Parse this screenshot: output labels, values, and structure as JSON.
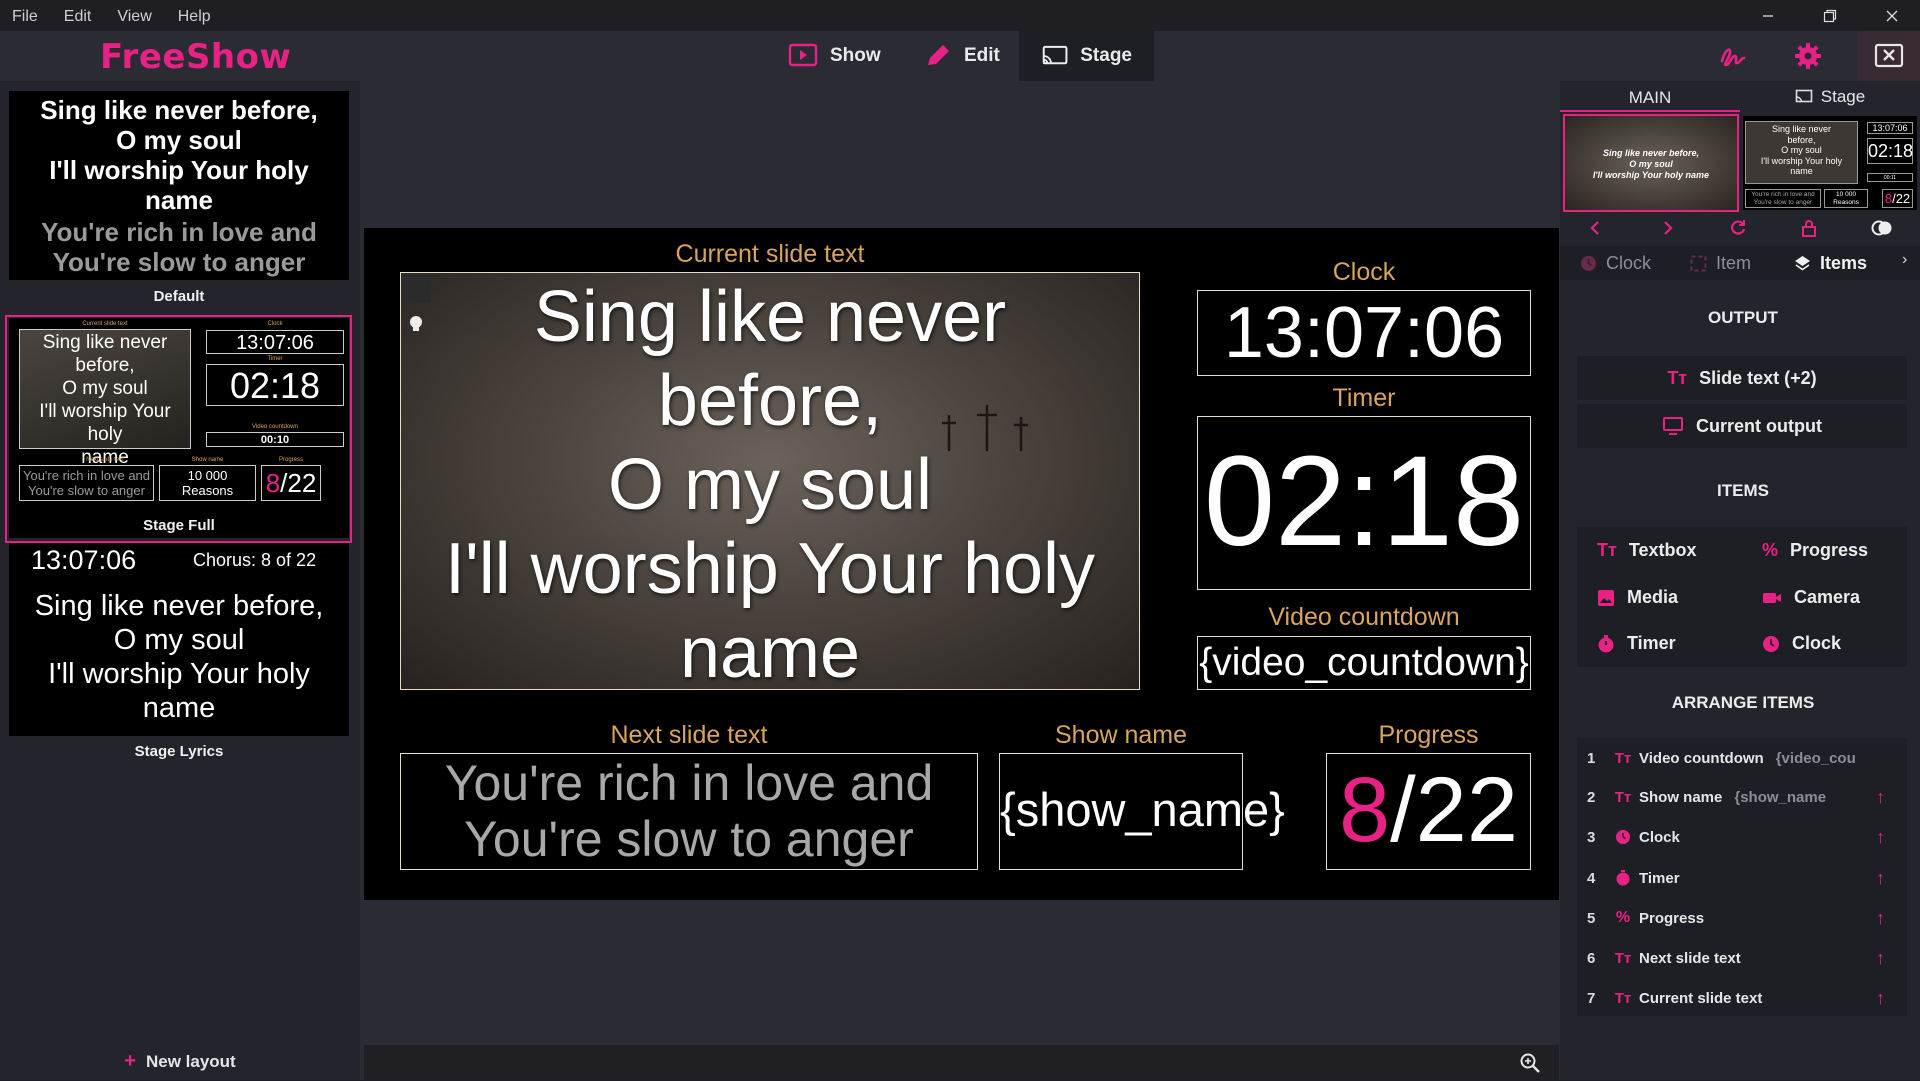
{
  "menu": [
    "File",
    "Edit",
    "View",
    "Help"
  ],
  "app": {
    "name": "FreeShow"
  },
  "nav": {
    "show": "Show",
    "edit": "Edit",
    "stage": "Stage"
  },
  "layouts": {
    "default": {
      "label": "Default",
      "current": [
        "Sing like never before,",
        "O my soul",
        "I'll worship Your holy",
        "name"
      ],
      "next": [
        "You're rich in love and",
        "You're slow to anger"
      ]
    },
    "stage_full": {
      "label": "Stage Full",
      "current_label": "Current slide text",
      "current": [
        "Sing like never",
        "before,",
        "O my soul",
        "I'll worship Your holy",
        "name"
      ],
      "clock_label": "Clock",
      "clock": "13:07:06",
      "timer_label": "Timer",
      "timer": "02:18",
      "video_label": "Video countdown",
      "video": "00:10",
      "next_label": "Next slide text",
      "next": [
        "You're rich in love and",
        "You're slow to anger"
      ],
      "show_label": "Show name",
      "show": [
        "10 000",
        "Reasons"
      ],
      "progress_label": "Progress",
      "progress_current": "8",
      "progress_total": "/22"
    },
    "stage_lyrics": {
      "label": "Stage Lyrics",
      "clock": "13:07:06",
      "chorus": "Chorus: 8 of 22",
      "lyrics": [
        "Sing like never before,",
        "O my soul",
        "I'll worship Your holy",
        "name"
      ]
    },
    "new_layout": "New layout"
  },
  "stage": {
    "current_label": "Current slide text",
    "current": [
      "Sing like never",
      "before,",
      "O my soul",
      "I'll worship Your holy",
      "name"
    ],
    "clock_label": "Clock",
    "clock": "13:07:06",
    "timer_label": "Timer",
    "timer": "02:18",
    "video_label": "Video countdown",
    "video": "{video_countdown}",
    "next_label": "Next slide text",
    "next": [
      "You're rich in love and",
      "You're slow to anger"
    ],
    "show_label": "Show name",
    "show": "{show_name}",
    "progress_label": "Progress",
    "progress_current": "8",
    "progress_total": "/22"
  },
  "preview": {
    "tab_main": "MAIN",
    "tab_stage": "Stage",
    "main_thumb": [
      "Sing like never before,",
      "O my soul",
      "I'll worship Your holy name"
    ],
    "stage_thumb": {
      "text": [
        "Sing like never",
        "before,",
        "O my soul",
        "I'll worship Your holy",
        "name"
      ],
      "clock": "13:07:06",
      "timer": "02:18",
      "video": "00:11",
      "next": [
        "You're rich in love and",
        "You're slow to anger"
      ],
      "show": [
        "10 000",
        "Reasons"
      ],
      "progress_current": "8",
      "progress_total": "/22"
    }
  },
  "tools": {
    "tabs": [
      "Clock",
      "Item",
      "Items"
    ],
    "output_title": "OUTPUT",
    "slide_text": "Slide text (+2)",
    "current_output": "Current output",
    "items_title": "ITEMS",
    "items": [
      "Textbox",
      "Progress",
      "Media",
      "Camera",
      "Timer",
      "Clock"
    ],
    "arrange_title": "ARRANGE ITEMS",
    "arrange": [
      {
        "num": "1",
        "name": "Video countdown",
        "value": "{video_cou",
        "icon": "text-icon"
      },
      {
        "num": "2",
        "name": "Show name",
        "value": "{show_name",
        "icon": "text-icon"
      },
      {
        "num": "3",
        "name": "Clock",
        "value": "",
        "icon": "clock-icon"
      },
      {
        "num": "4",
        "name": "Timer",
        "value": "",
        "icon": "timer-icon"
      },
      {
        "num": "5",
        "name": "Progress",
        "value": "",
        "icon": "percent-icon"
      },
      {
        "num": "6",
        "name": "Next slide text",
        "value": "",
        "icon": "text-icon"
      },
      {
        "num": "7",
        "name": "Current slide text",
        "value": "",
        "icon": "text-icon"
      }
    ]
  },
  "colors": {
    "accent": "#e82184",
    "label_gold": "#d9a45d",
    "panel": "#24252c",
    "bg": "#2a2b33"
  }
}
